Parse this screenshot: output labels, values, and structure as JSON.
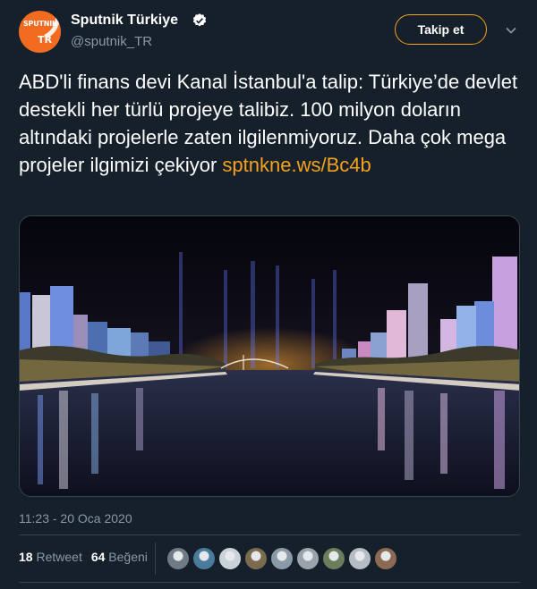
{
  "account": {
    "name": "Sputnik Türkiye",
    "handle": "@sputnik_TR",
    "avatar_word": "SPUTNIK",
    "avatar_badge": "TR",
    "verified": true,
    "avatar_color": "#f26b21"
  },
  "follow_button": {
    "label": "Takip et",
    "border_color": "#f5a21e"
  },
  "tweet": {
    "text": "ABD'li finans devi Kanal İstanbul'a talip: Türkiye’de devlet destekli her türlü projeye talibiz. 100 milyon doların altındaki projelerle zaten ilgilenmiyoruz. Daha çok mega projeler ilgimizi çekiyor",
    "link": "sptnkne.ws/Bc4b",
    "link_color": "#f5a21e"
  },
  "media": {
    "icon": "night-city-canal-image"
  },
  "timestamp": "11:23 - 20 Oca 2020",
  "stats": {
    "retweets_count": "18",
    "retweets_label": "Retweet",
    "likes_count": "64",
    "likes_label": "Beğeni"
  },
  "likers": [
    {
      "color": "#6e7b86"
    },
    {
      "color": "#4a7a9c"
    },
    {
      "color": "#c9d2da"
    },
    {
      "color": "#7a6a4f"
    },
    {
      "color": "#8a9aa6"
    },
    {
      "color": "#9aa3ab"
    },
    {
      "color": "#6b7d5a"
    },
    {
      "color": "#b5bcc3"
    },
    {
      "color": "#8a6a52"
    }
  ],
  "theme": {
    "background": "#15202b",
    "secondary_text": "#8899a6",
    "border": "#38444d"
  }
}
